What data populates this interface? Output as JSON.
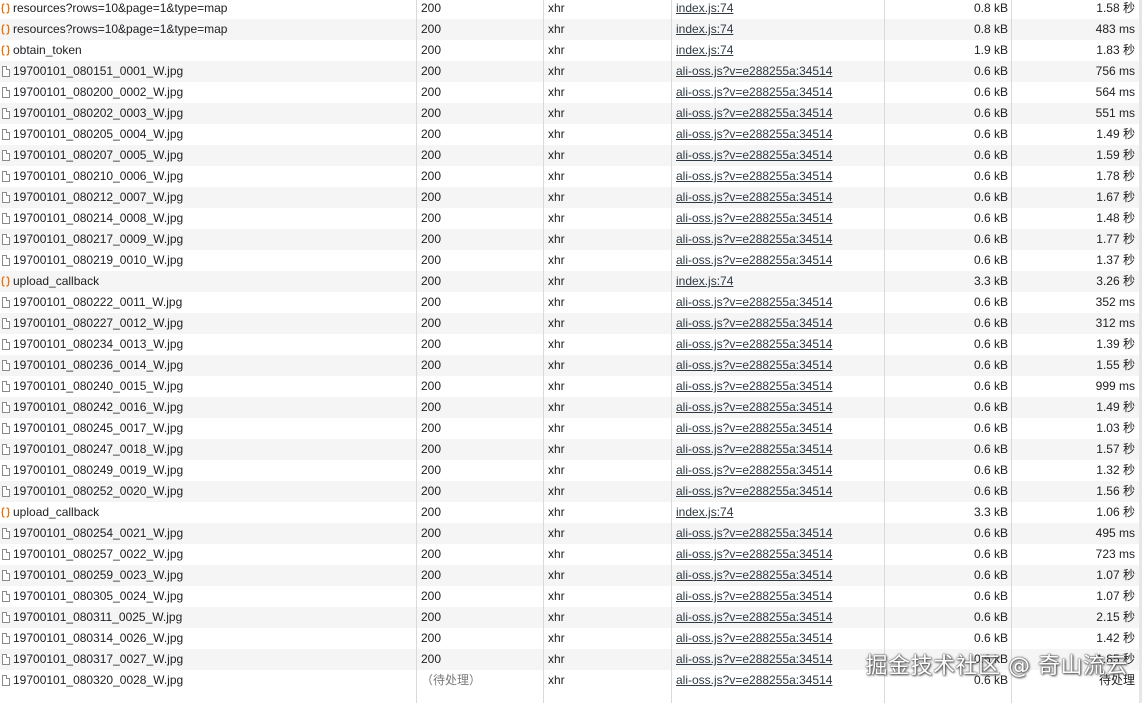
{
  "watermark": "掘金技术社区 @ 奇山流云",
  "requests": [
    {
      "name": "resources?rows=10&page=1&type=map",
      "icon": "xhr",
      "status": "200",
      "type": "xhr",
      "initiator": "index.js:74",
      "size": "0.8 kB",
      "time": "1.58 秒"
    },
    {
      "name": "resources?rows=10&page=1&type=map",
      "icon": "xhr",
      "status": "200",
      "type": "xhr",
      "initiator": "index.js:74",
      "size": "0.8 kB",
      "time": "483 ms"
    },
    {
      "name": "obtain_token",
      "icon": "xhr",
      "status": "200",
      "type": "xhr",
      "initiator": "index.js:74",
      "size": "1.9 kB",
      "time": "1.83 秒"
    },
    {
      "name": "19700101_080151_0001_W.jpg",
      "icon": "doc",
      "status": "200",
      "type": "xhr",
      "initiator": "ali-oss.js?v=e288255a:34514",
      "size": "0.6 kB",
      "time": "756 ms"
    },
    {
      "name": "19700101_080200_0002_W.jpg",
      "icon": "doc",
      "status": "200",
      "type": "xhr",
      "initiator": "ali-oss.js?v=e288255a:34514",
      "size": "0.6 kB",
      "time": "564 ms"
    },
    {
      "name": "19700101_080202_0003_W.jpg",
      "icon": "doc",
      "status": "200",
      "type": "xhr",
      "initiator": "ali-oss.js?v=e288255a:34514",
      "size": "0.6 kB",
      "time": "551 ms"
    },
    {
      "name": "19700101_080205_0004_W.jpg",
      "icon": "doc",
      "status": "200",
      "type": "xhr",
      "initiator": "ali-oss.js?v=e288255a:34514",
      "size": "0.6 kB",
      "time": "1.49 秒"
    },
    {
      "name": "19700101_080207_0005_W.jpg",
      "icon": "doc",
      "status": "200",
      "type": "xhr",
      "initiator": "ali-oss.js?v=e288255a:34514",
      "size": "0.6 kB",
      "time": "1.59 秒"
    },
    {
      "name": "19700101_080210_0006_W.jpg",
      "icon": "doc",
      "status": "200",
      "type": "xhr",
      "initiator": "ali-oss.js?v=e288255a:34514",
      "size": "0.6 kB",
      "time": "1.78 秒"
    },
    {
      "name": "19700101_080212_0007_W.jpg",
      "icon": "doc",
      "status": "200",
      "type": "xhr",
      "initiator": "ali-oss.js?v=e288255a:34514",
      "size": "0.6 kB",
      "time": "1.67 秒"
    },
    {
      "name": "19700101_080214_0008_W.jpg",
      "icon": "doc",
      "status": "200",
      "type": "xhr",
      "initiator": "ali-oss.js?v=e288255a:34514",
      "size": "0.6 kB",
      "time": "1.48 秒"
    },
    {
      "name": "19700101_080217_0009_W.jpg",
      "icon": "doc",
      "status": "200",
      "type": "xhr",
      "initiator": "ali-oss.js?v=e288255a:34514",
      "size": "0.6 kB",
      "time": "1.77 秒"
    },
    {
      "name": "19700101_080219_0010_W.jpg",
      "icon": "doc",
      "status": "200",
      "type": "xhr",
      "initiator": "ali-oss.js?v=e288255a:34514",
      "size": "0.6 kB",
      "time": "1.37 秒"
    },
    {
      "name": "upload_callback",
      "icon": "xhr",
      "status": "200",
      "type": "xhr",
      "initiator": "index.js:74",
      "size": "3.3 kB",
      "time": "3.26 秒"
    },
    {
      "name": "19700101_080222_0011_W.jpg",
      "icon": "doc",
      "status": "200",
      "type": "xhr",
      "initiator": "ali-oss.js?v=e288255a:34514",
      "size": "0.6 kB",
      "time": "352 ms"
    },
    {
      "name": "19700101_080227_0012_W.jpg",
      "icon": "doc",
      "status": "200",
      "type": "xhr",
      "initiator": "ali-oss.js?v=e288255a:34514",
      "size": "0.6 kB",
      "time": "312 ms"
    },
    {
      "name": "19700101_080234_0013_W.jpg",
      "icon": "doc",
      "status": "200",
      "type": "xhr",
      "initiator": "ali-oss.js?v=e288255a:34514",
      "size": "0.6 kB",
      "time": "1.39 秒"
    },
    {
      "name": "19700101_080236_0014_W.jpg",
      "icon": "doc",
      "status": "200",
      "type": "xhr",
      "initiator": "ali-oss.js?v=e288255a:34514",
      "size": "0.6 kB",
      "time": "1.55 秒"
    },
    {
      "name": "19700101_080240_0015_W.jpg",
      "icon": "doc",
      "status": "200",
      "type": "xhr",
      "initiator": "ali-oss.js?v=e288255a:34514",
      "size": "0.6 kB",
      "time": "999 ms"
    },
    {
      "name": "19700101_080242_0016_W.jpg",
      "icon": "doc",
      "status": "200",
      "type": "xhr",
      "initiator": "ali-oss.js?v=e288255a:34514",
      "size": "0.6 kB",
      "time": "1.49 秒"
    },
    {
      "name": "19700101_080245_0017_W.jpg",
      "icon": "doc",
      "status": "200",
      "type": "xhr",
      "initiator": "ali-oss.js?v=e288255a:34514",
      "size": "0.6 kB",
      "time": "1.03 秒"
    },
    {
      "name": "19700101_080247_0018_W.jpg",
      "icon": "doc",
      "status": "200",
      "type": "xhr",
      "initiator": "ali-oss.js?v=e288255a:34514",
      "size": "0.6 kB",
      "time": "1.57 秒"
    },
    {
      "name": "19700101_080249_0019_W.jpg",
      "icon": "doc",
      "status": "200",
      "type": "xhr",
      "initiator": "ali-oss.js?v=e288255a:34514",
      "size": "0.6 kB",
      "time": "1.32 秒"
    },
    {
      "name": "19700101_080252_0020_W.jpg",
      "icon": "doc",
      "status": "200",
      "type": "xhr",
      "initiator": "ali-oss.js?v=e288255a:34514",
      "size": "0.6 kB",
      "time": "1.56 秒"
    },
    {
      "name": "upload_callback",
      "icon": "xhr",
      "status": "200",
      "type": "xhr",
      "initiator": "index.js:74",
      "size": "3.3 kB",
      "time": "1.06 秒"
    },
    {
      "name": "19700101_080254_0021_W.jpg",
      "icon": "doc",
      "status": "200",
      "type": "xhr",
      "initiator": "ali-oss.js?v=e288255a:34514",
      "size": "0.6 kB",
      "time": "495 ms"
    },
    {
      "name": "19700101_080257_0022_W.jpg",
      "icon": "doc",
      "status": "200",
      "type": "xhr",
      "initiator": "ali-oss.js?v=e288255a:34514",
      "size": "0.6 kB",
      "time": "723 ms"
    },
    {
      "name": "19700101_080259_0023_W.jpg",
      "icon": "doc",
      "status": "200",
      "type": "xhr",
      "initiator": "ali-oss.js?v=e288255a:34514",
      "size": "0.6 kB",
      "time": "1.07 秒"
    },
    {
      "name": "19700101_080305_0024_W.jpg",
      "icon": "doc",
      "status": "200",
      "type": "xhr",
      "initiator": "ali-oss.js?v=e288255a:34514",
      "size": "0.6 kB",
      "time": "1.07 秒"
    },
    {
      "name": "19700101_080311_0025_W.jpg",
      "icon": "doc",
      "status": "200",
      "type": "xhr",
      "initiator": "ali-oss.js?v=e288255a:34514",
      "size": "0.6 kB",
      "time": "2.15 秒"
    },
    {
      "name": "19700101_080314_0026_W.jpg",
      "icon": "doc",
      "status": "200",
      "type": "xhr",
      "initiator": "ali-oss.js?v=e288255a:34514",
      "size": "0.6 kB",
      "time": "1.42 秒"
    },
    {
      "name": "19700101_080317_0027_W.jpg",
      "icon": "doc",
      "status": "200",
      "type": "xhr",
      "initiator": "ali-oss.js?v=e288255a:34514",
      "size": "0.6 kB",
      "time": "1.85 秒"
    },
    {
      "name": "19700101_080320_0028_W.jpg",
      "icon": "doc",
      "status": "（待处理）",
      "type": "xhr",
      "initiator": "ali-oss.js?v=e288255a:34514",
      "size": "0.6 kB",
      "time": "待处理"
    }
  ]
}
